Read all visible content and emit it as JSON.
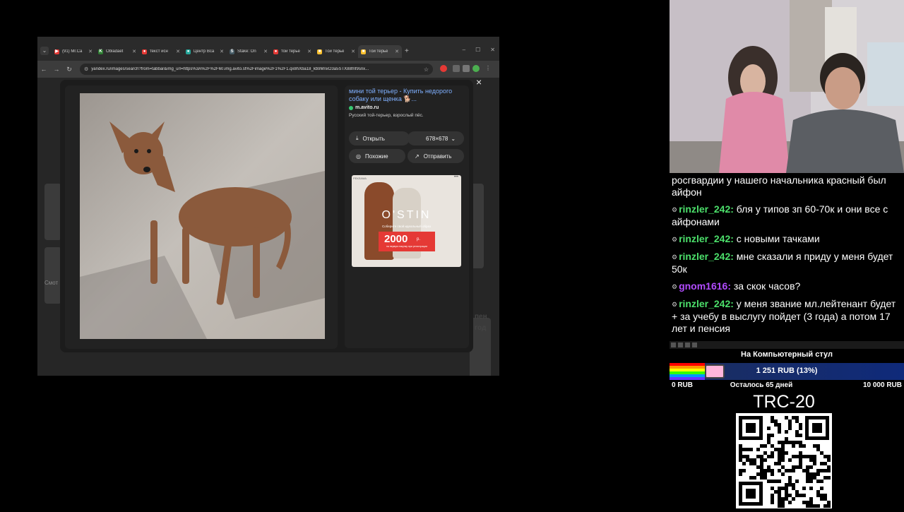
{
  "browser": {
    "tabs": [
      {
        "label": "(91) Mr.Ca",
        "fav_color": "#e53935",
        "fav": "▶",
        "active": false
      },
      {
        "label": "Obladaet",
        "fav_color": "#2e7d32",
        "fav": "K",
        "active": false
      },
      {
        "label": "текст исн",
        "fav_color": "#e53935",
        "fav": "●",
        "active": false
      },
      {
        "label": "Центр Вса",
        "fav_color": "#26a69a",
        "fav": "●",
        "active": false
      },
      {
        "label": "Stake: On",
        "fav_color": "#455a64",
        "fav": "S",
        "active": false
      },
      {
        "label": "той терье",
        "fav_color": "#e53935",
        "fav": "●",
        "active": false
      },
      {
        "label": "Той терье",
        "fav_color": "#fbc02d",
        "fav": "■",
        "active": false
      },
      {
        "label": "Той терье",
        "fav_color": "#fbc02d",
        "fav": "■",
        "active": true
      }
    ],
    "new_tab": "+",
    "url": "yandex.ru/images/search?from=tabbar&img_url=https%3A%2F%2F60.img.avito.st%2Fimage%2F1%2F1.qx8hXba18_kb9MnxO3a5STX88fnf9snx..."
  },
  "preview": {
    "title": "мини той терьер - Купить недорого собаку или щенка 🐕...",
    "source": "m.avito.ru",
    "description": "Русский той-терьер, взрослый пёс.",
    "open_label": "Открыть",
    "size_label": "678×678",
    "similar_label": "Похожие",
    "share_label": "Отправить",
    "close": "×",
    "ad": {
      "brand": "O'STIN",
      "promo": "Соберите свой идеальный образ",
      "amount": "2000",
      "currency": "р.",
      "note": "на первую покупку при регистрации",
      "tag": "РЕКЛАМА",
      "more": "•••"
    },
    "side_text_1": "Смот",
    "side_text_2": "пен",
    "side_text_3": "год"
  },
  "chat": {
    "messages": [
      {
        "user": "",
        "text": "росгвардии у нашего начальника красный был айфон",
        "color": ""
      },
      {
        "user": "rinzler_242:",
        "text": " бля у типов зп 60-70к и они все с айфонами",
        "color": "green"
      },
      {
        "user": "rinzler_242:",
        "text": " с новыми тачками",
        "color": "green"
      },
      {
        "user": "rinzler_242:",
        "text": " мне сказали я приду у меня будет 50к",
        "color": "green"
      },
      {
        "user": "gnom1616:",
        "text": " за скок часов?",
        "color": "purple"
      },
      {
        "user": "rinzler_242:",
        "text": " у меня звание мл.лейтенант будет + за учебу в выслугу пойдет (3 года) а потом 17 лет и пенсия",
        "color": "green"
      }
    ]
  },
  "goal": {
    "title": "На Компьютерный стул",
    "amount": "1 251 RUB (13%)",
    "progress": 0.13,
    "min": "0 RUB",
    "remaining": "Осталось 65 дней",
    "max": "10 000 RUB"
  },
  "crypto": {
    "label": "TRC-20"
  }
}
